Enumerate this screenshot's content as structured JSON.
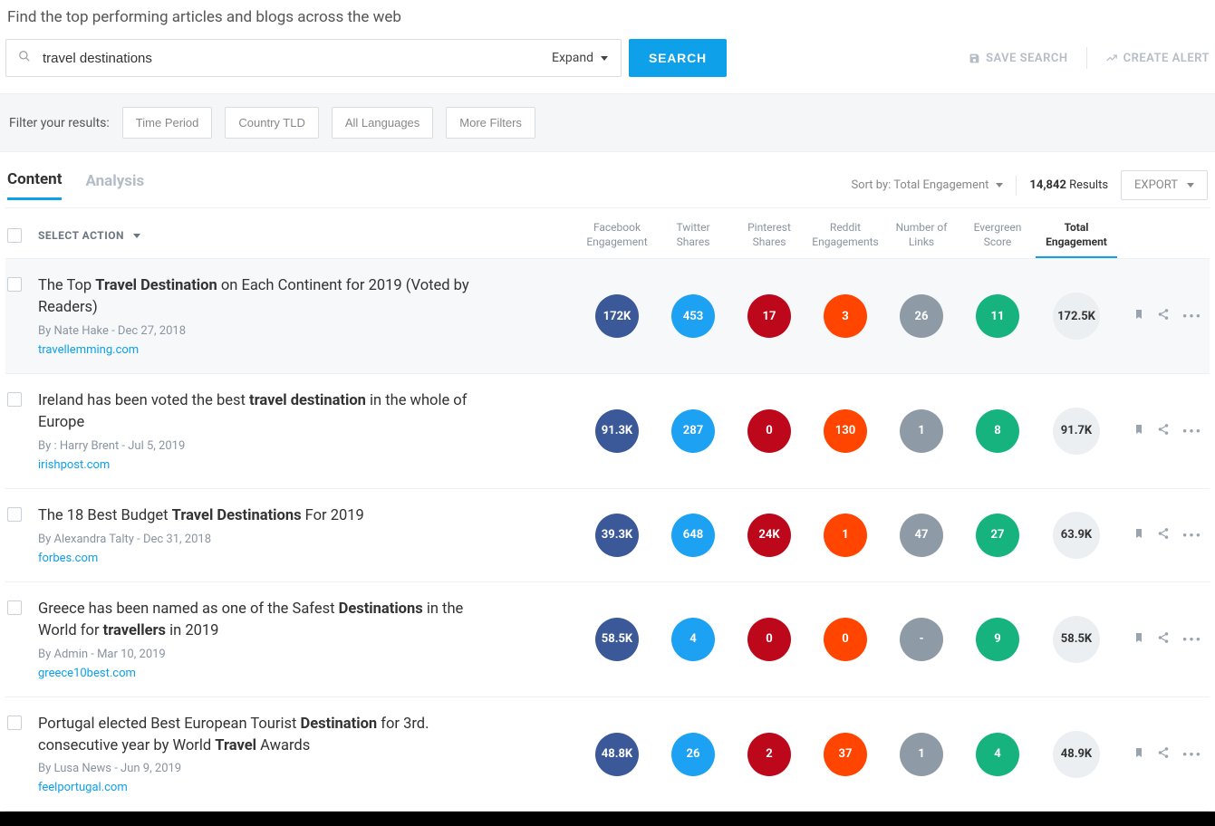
{
  "heading": "Find the top performing articles and blogs across the web",
  "search": {
    "value": "travel destinations",
    "expand": "Expand",
    "button": "SEARCH"
  },
  "rightActions": {
    "save": "SAVE SEARCH",
    "alert": "CREATE ALERT"
  },
  "filters": {
    "label": "Filter your results:",
    "buttons": [
      "Time Period",
      "Country TLD",
      "All Languages",
      "More Filters"
    ]
  },
  "tabs": {
    "content": "Content",
    "analysis": "Analysis"
  },
  "sort": {
    "label": "Sort by: Total Engagement",
    "resultsCount": "14,842",
    "resultsLabel": " Results",
    "export": "EXPORT"
  },
  "columns": {
    "selectAction": "SELECT ACTION",
    "fb1": "Facebook",
    "fb2": "Engagement",
    "tw1": "Twitter",
    "tw2": "Shares",
    "pin1": "Pinterest",
    "pin2": "Shares",
    "rd1": "Reddit",
    "rd2": "Engagements",
    "links1": "Number of",
    "links2": "Links",
    "ev1": "Evergreen",
    "ev2": "Score",
    "tot1": "Total",
    "tot2": "Engagement"
  },
  "rows": [
    {
      "titleParts": [
        "The Top ",
        "Travel Destination",
        " on Each Continent for 2019 (Voted by Readers)"
      ],
      "boldIdx": [
        1
      ],
      "byline": "By Nate Hake - Dec 27, 2018",
      "domain": "travellemming.com",
      "fb": "172K",
      "tw": "453",
      "pin": "17",
      "rd": "3",
      "links": "26",
      "ever": "11",
      "total": "172.5K"
    },
    {
      "titleParts": [
        "Ireland has been voted the best ",
        "travel destination",
        " in the whole of Europe"
      ],
      "boldIdx": [
        1
      ],
      "byline": "By : Harry Brent - Jul 5, 2019",
      "domain": "irishpost.com",
      "fb": "91.3K",
      "tw": "287",
      "pin": "0",
      "rd": "130",
      "links": "1",
      "ever": "8",
      "total": "91.7K"
    },
    {
      "titleParts": [
        "The 18 Best Budget ",
        "Travel Destinations",
        " For 2019"
      ],
      "boldIdx": [
        1
      ],
      "byline": "By Alexandra Talty - Dec 31, 2018",
      "domain": "forbes.com",
      "fb": "39.3K",
      "tw": "648",
      "pin": "24K",
      "rd": "1",
      "links": "47",
      "ever": "27",
      "total": "63.9K"
    },
    {
      "titleParts": [
        "Greece has been named as one of the Safest ",
        "Destinations",
        " in the World for ",
        "travellers",
        " in 2019"
      ],
      "boldIdx": [
        1,
        3
      ],
      "byline": "By Admin - Mar 10, 2019",
      "domain": "greece10best.com",
      "fb": "58.5K",
      "tw": "4",
      "pin": "0",
      "rd": "0",
      "links": "-",
      "ever": "9",
      "total": "58.5K"
    },
    {
      "titleParts": [
        "Portugal elected Best European Tourist ",
        "Destination",
        " for 3rd. consecutive year by World ",
        "Travel",
        " Awards"
      ],
      "boldIdx": [
        1,
        3
      ],
      "byline": "By Lusa News - Jun 9, 2019",
      "domain": "feelportugal.com",
      "fb": "48.8K",
      "tw": "26",
      "pin": "2",
      "rd": "37",
      "links": "1",
      "ever": "4",
      "total": "48.9K"
    }
  ]
}
